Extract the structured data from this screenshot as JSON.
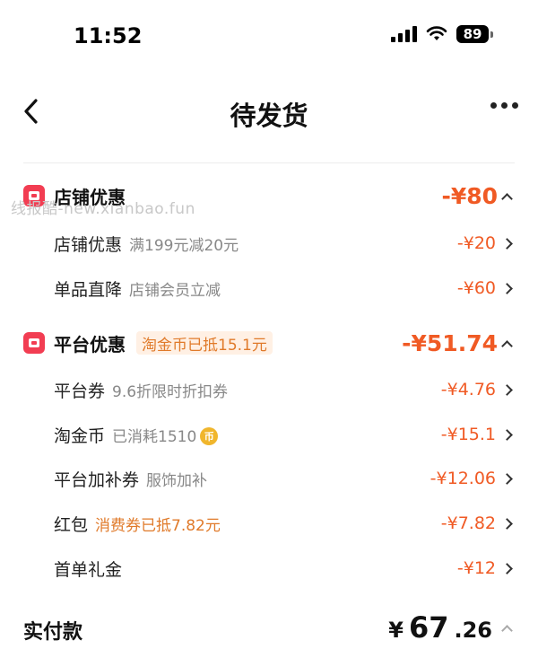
{
  "status_bar": {
    "time": "11:52",
    "battery": "89"
  },
  "header": {
    "title": "待发货"
  },
  "watermark": "线报酷-new.xianbao.fun",
  "store_discount": {
    "title": "店铺优惠",
    "total": "-¥80",
    "items": [
      {
        "label": "店铺优惠",
        "desc": "满199元减20元",
        "amount": "-¥20"
      },
      {
        "label": "单品直降",
        "desc": "店铺会员立减",
        "amount": "-¥60"
      }
    ]
  },
  "platform_discount": {
    "title": "平台优惠",
    "tag": "淘金币已抵15.1元",
    "total": "-¥51.74",
    "items": [
      {
        "label": "平台券",
        "desc": "9.6折限时折扣券",
        "amount": "-¥4.76"
      },
      {
        "label": "淘金币",
        "desc": "已消耗1510",
        "amount": "-¥15.1",
        "icon": "coin-icon"
      },
      {
        "label": "平台加补券",
        "desc": "服饰加补",
        "amount": "-¥12.06"
      },
      {
        "label": "红包",
        "desc": "消费券已抵7.82元",
        "amount": "-¥7.82"
      },
      {
        "label": "首单礼金",
        "desc": "",
        "amount": "-¥12"
      }
    ]
  },
  "total": {
    "label": "实付款",
    "currency": "¥",
    "integer": "67",
    "decimal": ".26"
  },
  "colors": {
    "accent": "#f05a24",
    "icon_red": "#f23d52",
    "tag_bg": "#fff0e4",
    "tag_text": "#e07a2a"
  }
}
